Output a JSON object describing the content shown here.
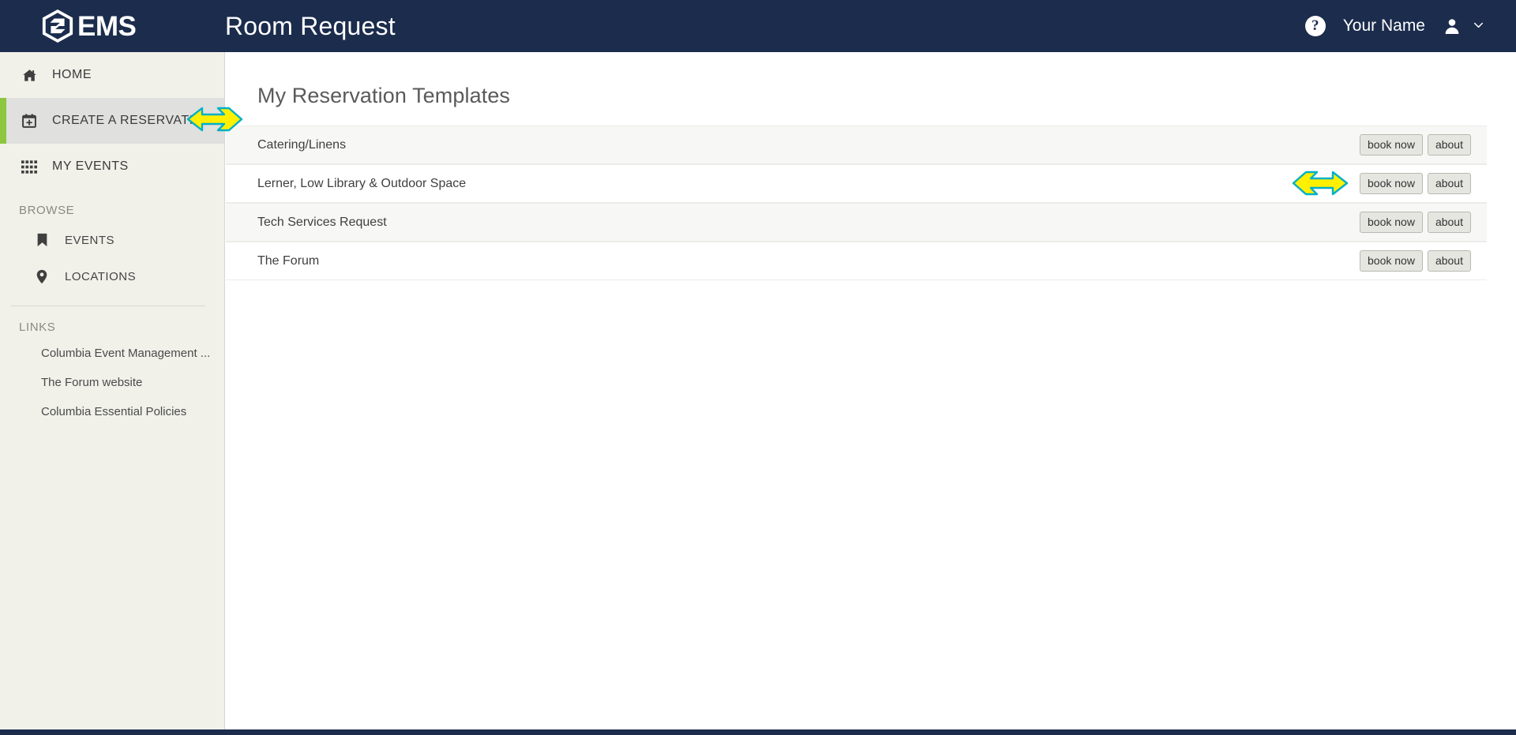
{
  "header": {
    "logo_text": "EMS",
    "logo_icon": "ems-hexagon-logo",
    "title": "Room Request",
    "help_icon": "help-question-icon",
    "help_label": "?",
    "user_name": "Your Name",
    "avatar_icon": "user-avatar-icon",
    "caret_icon": "chevron-down-icon"
  },
  "sidebar": {
    "primary": [
      {
        "label": "HOME",
        "icon": "home-icon",
        "active": false
      },
      {
        "label": "CREATE A RESERVATION",
        "icon": "calendar-plus-icon",
        "active": true
      },
      {
        "label": "MY EVENTS",
        "icon": "grid-icon",
        "active": false
      }
    ],
    "browse_heading": "BROWSE",
    "browse": [
      {
        "label": "EVENTS",
        "icon": "bookmark-icon"
      },
      {
        "label": "LOCATIONS",
        "icon": "map-pin-icon"
      }
    ],
    "links_heading": "LINKS",
    "links": [
      {
        "label": "Columbia Event Management ..."
      },
      {
        "label": "The Forum website"
      },
      {
        "label": "Columbia Essential Policies"
      }
    ]
  },
  "main": {
    "heading": "My Reservation Templates",
    "book_now_label": "book now",
    "about_label": "about",
    "templates": [
      {
        "name": "Catering/Linens"
      },
      {
        "name": "Lerner, Low Library & Outdoor Space"
      },
      {
        "name": "Tech Services Request"
      },
      {
        "name": "The Forum"
      }
    ]
  },
  "annotations": [
    {
      "name": "arrow-pointing-to-create-a-reservation",
      "direction": "left"
    },
    {
      "name": "arrow-pointing-to-book-now-row-2",
      "direction": "right"
    }
  ],
  "colors": {
    "header_bg": "#1b2c4d",
    "sidebar_bg": "#f1f1ea",
    "active_accent": "#8dc63f",
    "annotation_fill": "#ffef00",
    "annotation_stroke": "#00b0c8"
  }
}
